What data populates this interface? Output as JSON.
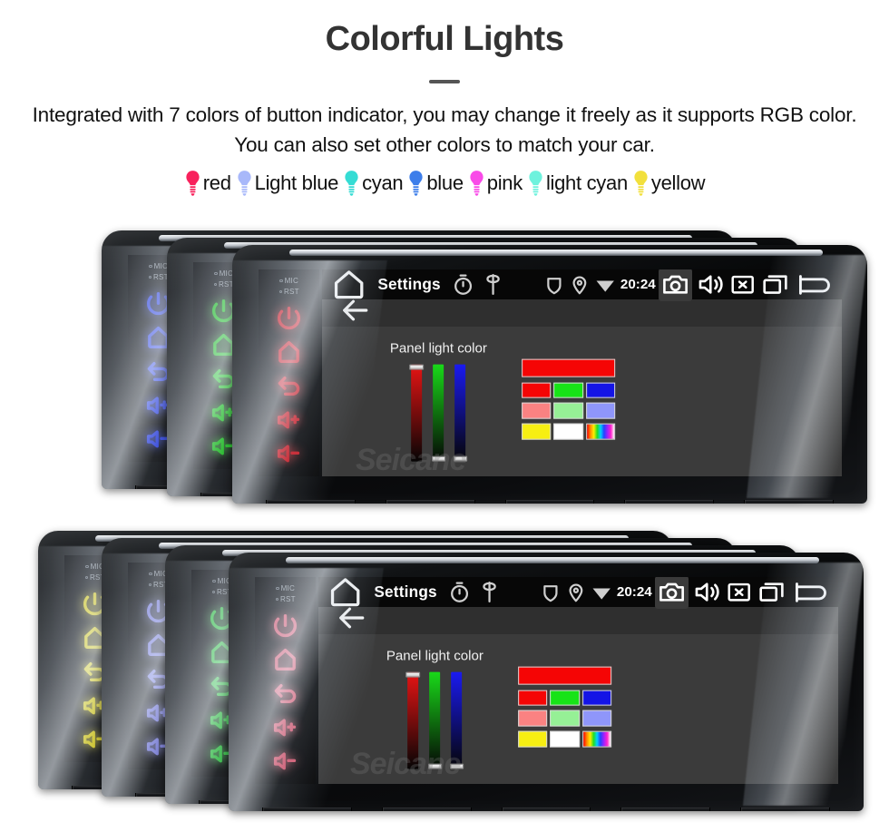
{
  "header": {
    "title": "Colorful Lights",
    "subtitle": "Integrated with 7 colors of button indicator, you may change it freely as it supports RGB color. You can also set other colors to match your car."
  },
  "legend": {
    "items": [
      {
        "label": "red",
        "color": "#f8215c",
        "icon": "bulb-icon"
      },
      {
        "label": "Light blue",
        "color": "#a8b8fa",
        "icon": "bulb-icon"
      },
      {
        "label": "cyan",
        "color": "#35dcd4",
        "icon": "bulb-icon"
      },
      {
        "label": "blue",
        "color": "#3d7eea",
        "icon": "bulb-icon"
      },
      {
        "label": "pink",
        "color": "#f94ae8",
        "icon": "bulb-icon"
      },
      {
        "label": "light cyan",
        "color": "#6ef2dd",
        "icon": "bulb-icon"
      },
      {
        "label": "yellow",
        "color": "#f2e03c",
        "icon": "bulb-icon"
      }
    ]
  },
  "device": {
    "hardkeys": {
      "mic_label": "MIC",
      "rst_label": "RST",
      "buttons": [
        "power-icon",
        "home-icon",
        "back-icon",
        "volume-up-icon",
        "volume-down-icon"
      ]
    },
    "statusbar": {
      "home_icon": "home-icon",
      "title": "Settings",
      "mini_icons": [
        "timer-icon",
        "location-pin-icon"
      ],
      "right_icons": [
        "shield-icon",
        "gps-icon",
        "wifi-icon"
      ],
      "time": "20:24",
      "action_icons": [
        "camera-icon",
        "volume-icon",
        "close-icon",
        "recents-icon",
        "back-arrow-icon"
      ]
    },
    "subbar": {
      "back_icon": "back-arrow-icon"
    },
    "settings": {
      "panel_label": "Panel light color",
      "sliders": [
        {
          "name": "red-slider",
          "color": "#e81414",
          "value": 100
        },
        {
          "name": "green-slider",
          "color": "#19d919",
          "value": 0
        },
        {
          "name": "blue-slider",
          "color": "#1a1af0",
          "value": 0
        }
      ],
      "preview_color": "#f50505",
      "swatches": [
        [
          "#f50505",
          "#17e317",
          "#1414e6"
        ],
        [
          "#fa8282",
          "#96f096",
          "#8f96fa"
        ],
        [
          "#f7ef12",
          "#ffffff",
          "rainbow"
        ]
      ]
    }
  },
  "groups": {
    "top": {
      "name": "top-device-group",
      "units": [
        {
          "name": "unit-blue",
          "key_color": "#2b3fe8",
          "glow": "#4a5cff"
        },
        {
          "name": "unit-green",
          "key_color": "#14c414",
          "glow": "#3ae03a"
        },
        {
          "name": "unit-red",
          "key_color": "#d6141e",
          "glow": "#ff3a42"
        }
      ]
    },
    "bottom": {
      "name": "bottom-device-group",
      "units": [
        {
          "name": "unit-yellow",
          "key_color": "#ded017",
          "glow": "#f5e83c"
        },
        {
          "name": "unit-light-blue",
          "key_color": "#7a7ce0",
          "glow": "#9b9dff"
        },
        {
          "name": "unit-green-2",
          "key_color": "#2cc43a",
          "glow": "#4ce05a"
        },
        {
          "name": "unit-pink",
          "key_color": "#e05a72",
          "glow": "#ff7c92"
        }
      ]
    }
  },
  "watermark": {
    "text": "Seicane"
  }
}
